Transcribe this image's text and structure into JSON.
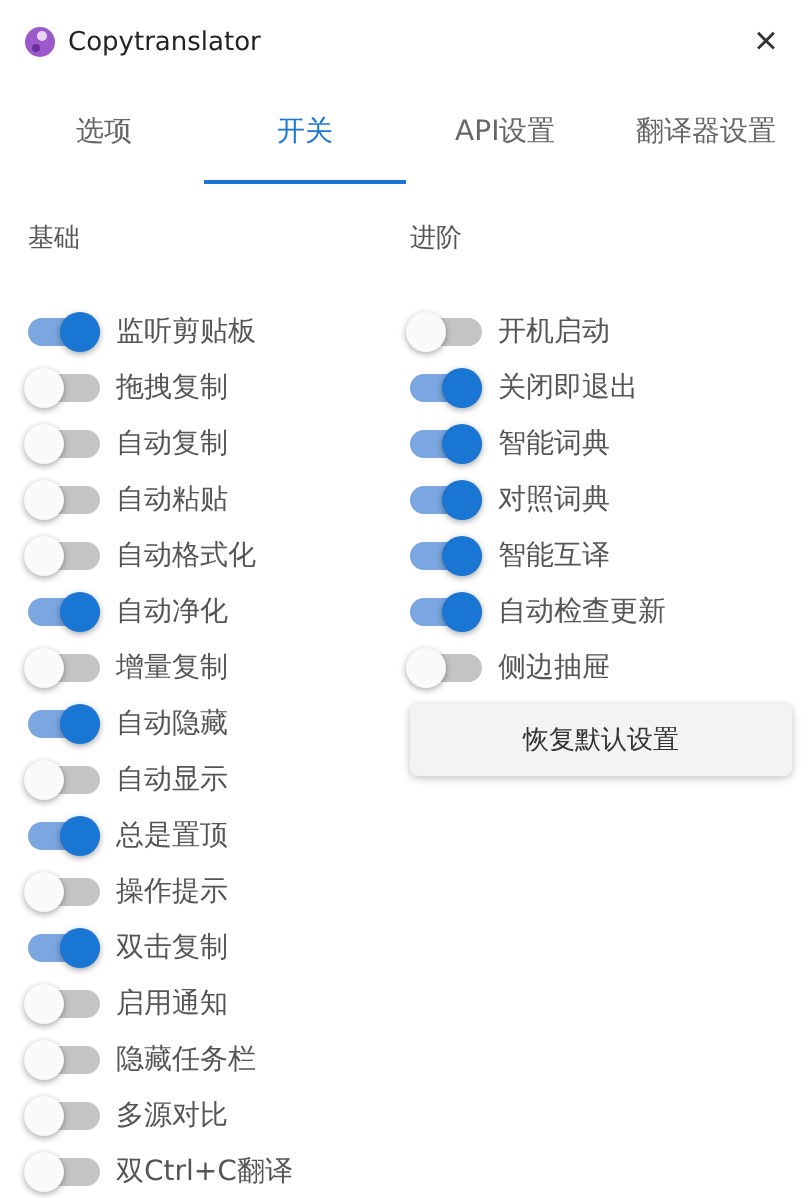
{
  "window": {
    "title": "Copytranslator",
    "close": "×"
  },
  "tabs": [
    {
      "label": "选项",
      "selected": false
    },
    {
      "label": "开关",
      "selected": true
    },
    {
      "label": "API设置",
      "selected": false
    },
    {
      "label": "翻译器设置",
      "selected": false
    }
  ],
  "columns": [
    {
      "title": "基础",
      "switches": [
        {
          "label": "监听剪贴板",
          "on": true
        },
        {
          "label": "拖拽复制",
          "on": false
        },
        {
          "label": "自动复制",
          "on": false
        },
        {
          "label": "自动粘贴",
          "on": false
        },
        {
          "label": "自动格式化",
          "on": false
        },
        {
          "label": "自动净化",
          "on": true
        },
        {
          "label": "增量复制",
          "on": false
        },
        {
          "label": "自动隐藏",
          "on": true
        },
        {
          "label": "自动显示",
          "on": false
        },
        {
          "label": "总是置顶",
          "on": true
        },
        {
          "label": "操作提示",
          "on": false
        },
        {
          "label": "双击复制",
          "on": true
        },
        {
          "label": "启用通知",
          "on": false
        },
        {
          "label": "隐藏任务栏",
          "on": false
        },
        {
          "label": "多源对比",
          "on": false
        },
        {
          "label": "双Ctrl+C翻译",
          "on": false
        }
      ]
    },
    {
      "title": "进阶",
      "switches": [
        {
          "label": "开机启动",
          "on": false
        },
        {
          "label": "关闭即退出",
          "on": true
        },
        {
          "label": "智能词典",
          "on": true
        },
        {
          "label": "对照词典",
          "on": true
        },
        {
          "label": "智能互译",
          "on": true
        },
        {
          "label": "自动检查更新",
          "on": true
        },
        {
          "label": "侧边抽屉",
          "on": false
        }
      ],
      "button": "恢复默认设置"
    }
  ]
}
